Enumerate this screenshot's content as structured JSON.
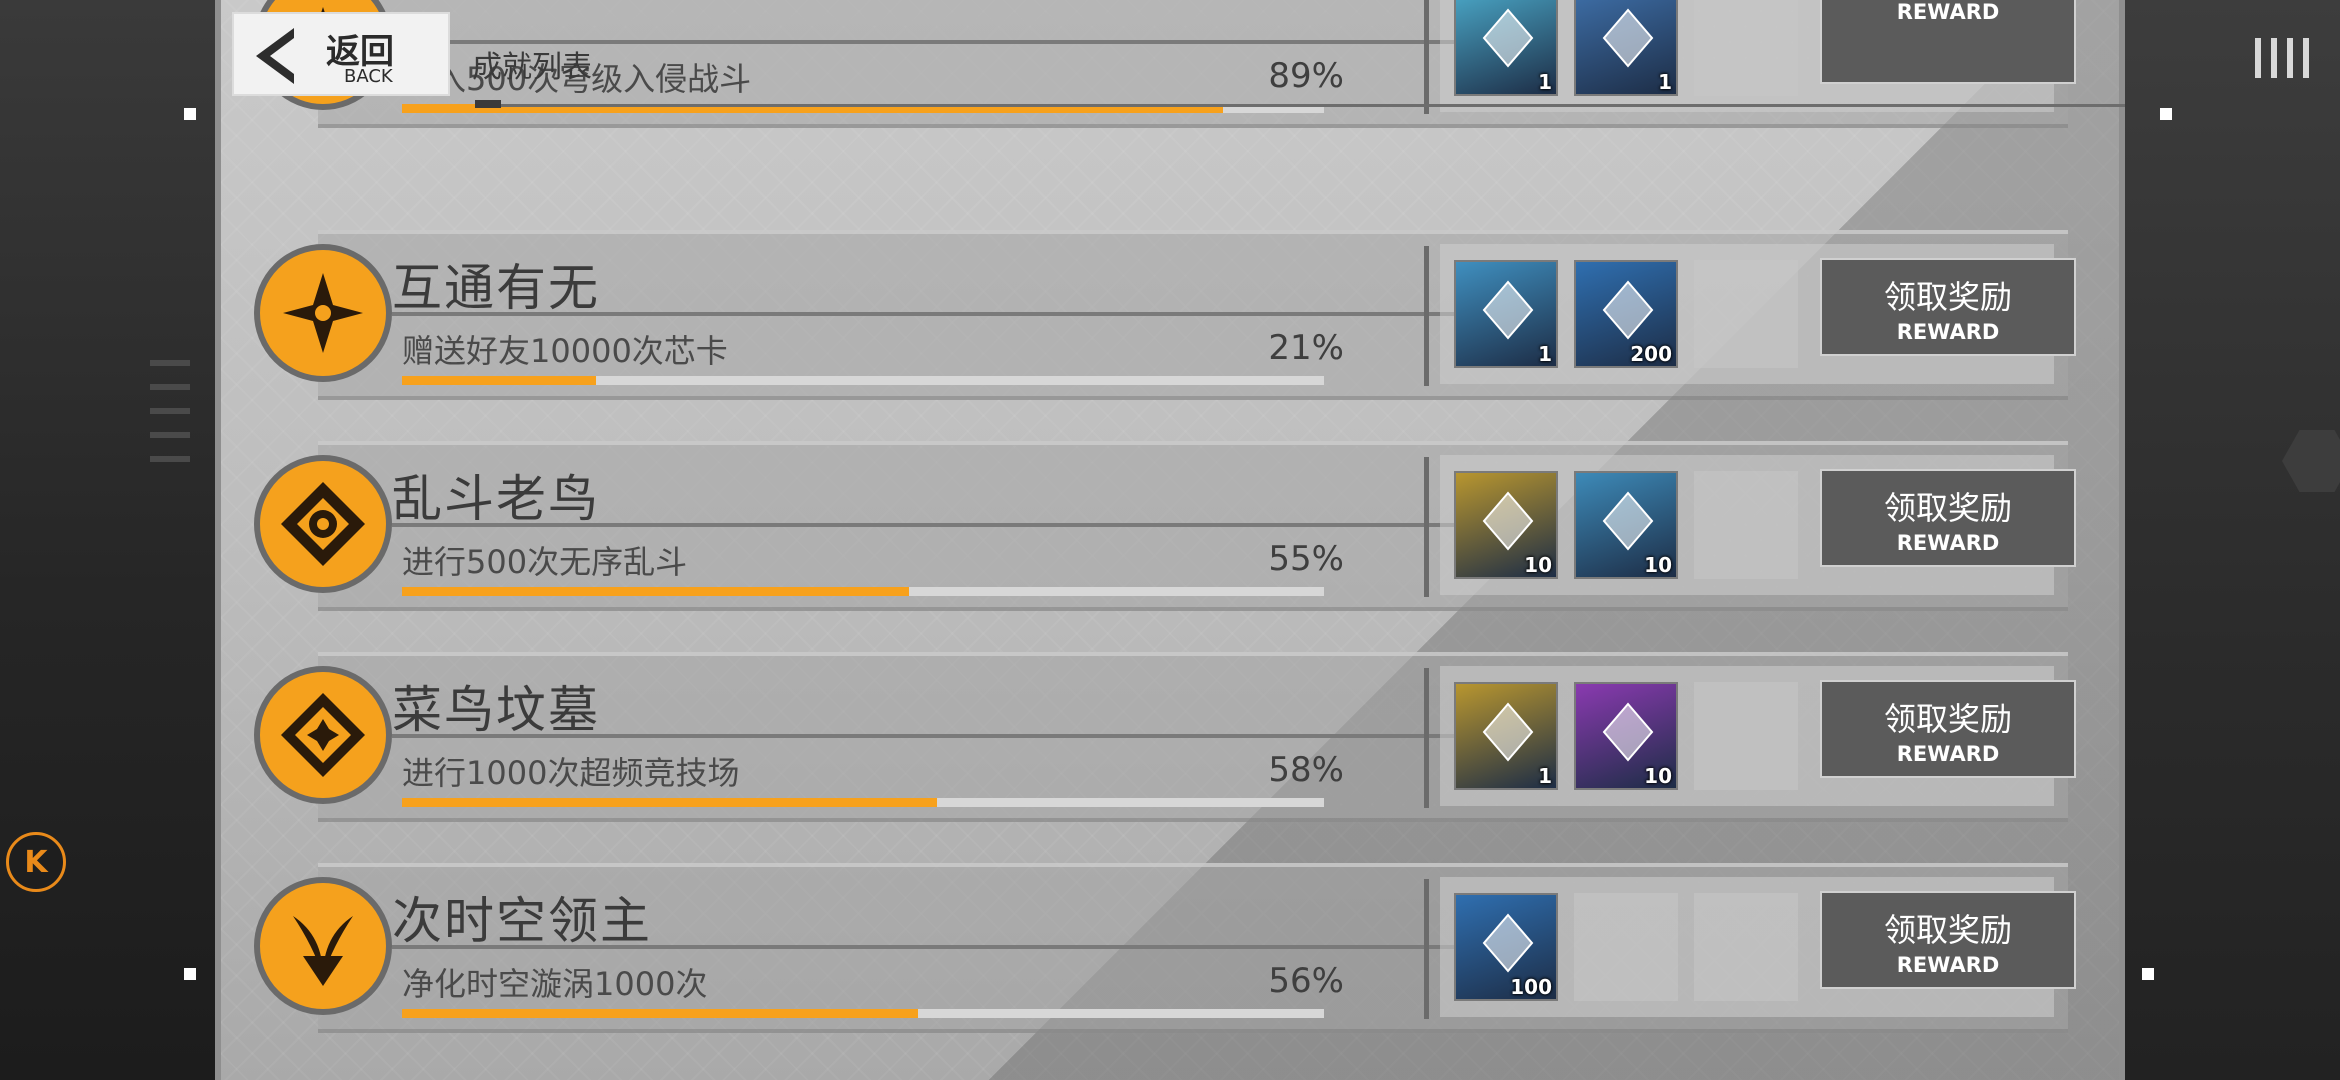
{
  "header": {
    "back_cn": "返回",
    "back_en": "BACK",
    "title": "成就列表"
  },
  "side": {
    "k_badge": "K"
  },
  "achievements": [
    {
      "name": "",
      "desc": "加入500次穹级入侵战斗",
      "pct": "89%",
      "progress": 0.89,
      "rewards": [
        {
          "icon": "purple-chest-icon",
          "qty": "1",
          "bg": "#4aa7c7"
        },
        {
          "icon": "blue-blade-icon",
          "qty": "1",
          "bg": "#3e6fa8"
        }
      ],
      "claim_cn": "",
      "claim_en": "REWARD"
    },
    {
      "name": "互通有无",
      "desc": "赠送好友10000次芯卡",
      "pct": "21%",
      "progress": 0.21,
      "rewards": [
        {
          "icon": "tag-icon",
          "qty": "1",
          "bg": "#3f8fbf"
        },
        {
          "icon": "blue-crystal-icon",
          "qty": "200",
          "bg": "#2f6fb0"
        }
      ],
      "claim_cn": "领取奖励",
      "claim_en": "REWARD"
    },
    {
      "name": "乱斗老鸟",
      "desc": "进行500次无序乱斗",
      "pct": "55%",
      "progress": 0.55,
      "rewards": [
        {
          "icon": "gold-badge-icon",
          "qty": "10",
          "bg": "#b8962f"
        },
        {
          "icon": "cube-box-icon",
          "qty": "10",
          "bg": "#3d8ab8"
        }
      ],
      "claim_cn": "领取奖励",
      "claim_en": "REWARD"
    },
    {
      "name": "菜鸟坟墓",
      "desc": "进行1000次超频竞技场",
      "pct": "58%",
      "progress": 0.58,
      "rewards": [
        {
          "icon": "silver-triangle-icon",
          "qty": "1",
          "bg": "#b8962f"
        },
        {
          "icon": "purple-badge-icon",
          "qty": "10",
          "bg": "#8a3ab0"
        }
      ],
      "claim_cn": "领取奖励",
      "claim_en": "REWARD"
    },
    {
      "name": "次时空领主",
      "desc": "净化时空漩涡1000次",
      "pct": "56%",
      "progress": 0.56,
      "rewards": [
        {
          "icon": "blue-crystal-icon",
          "qty": "100",
          "bg": "#2f6fb0"
        }
      ],
      "claim_cn": "领取奖励",
      "claim_en": "REWARD"
    }
  ]
}
